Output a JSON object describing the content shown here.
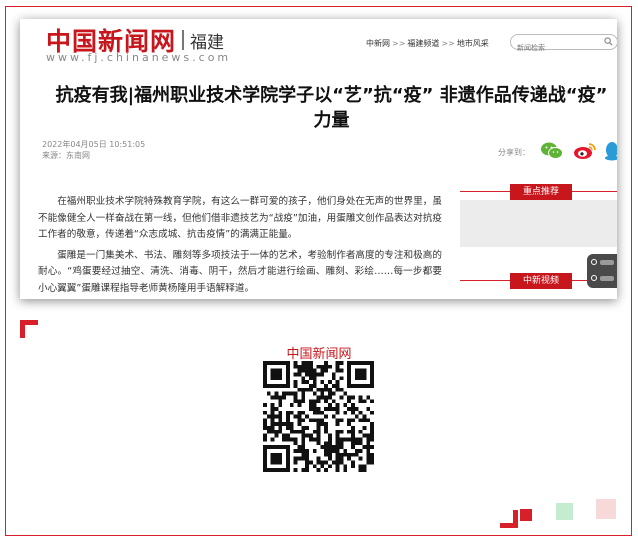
{
  "site": {
    "logo_cn": "中国新闻网",
    "region": "福建",
    "url": "www.fj.chinanews.com"
  },
  "breadcrumb": {
    "items": [
      "中新网",
      "福建频道",
      "地市风采"
    ],
    "separator": ">>"
  },
  "search": {
    "placeholder": "新闻检索"
  },
  "article": {
    "title_line1": "抗疫有我|福州职业技术学院学子以“艺”抗“疫” 非遗作品传递战“疫”",
    "title_line2": "力量",
    "datetime": "2022年04月05日 10:51:05",
    "source": "来源：东南网",
    "paragraphs": [
      "在福州职业技术学院特殊教育学院，有这么一群可爱的孩子，他们身处在无声的世界里，虽不能像健全人一样奋战在第一线，但他们借非遗技艺为“战疫”加油，用蛋雕文创作品表达对抗疫工作者的敬意，传递着“众志成城、抗击疫情”的满满正能量。",
      "蛋雕是一门集美术、书法、雕刻等多项技法于一体的艺术，考验制作者高度的专注和极高的耐心。“鸡蛋要经过抽空、清洗、消毒、阴干，然后才能进行绘画、雕刻、彩绘……每一步都要小心翼翼”蛋雕课程指导老师黄杨隆用手语解释道。"
    ]
  },
  "share": {
    "label": "分享到："
  },
  "sidebar": {
    "tab1": "重点推荐",
    "tab2": "中新视频"
  },
  "qr": {
    "label": "中国新闻网"
  },
  "colors": {
    "brand_red": "#c8161d",
    "frame_red": "#d8202a"
  }
}
